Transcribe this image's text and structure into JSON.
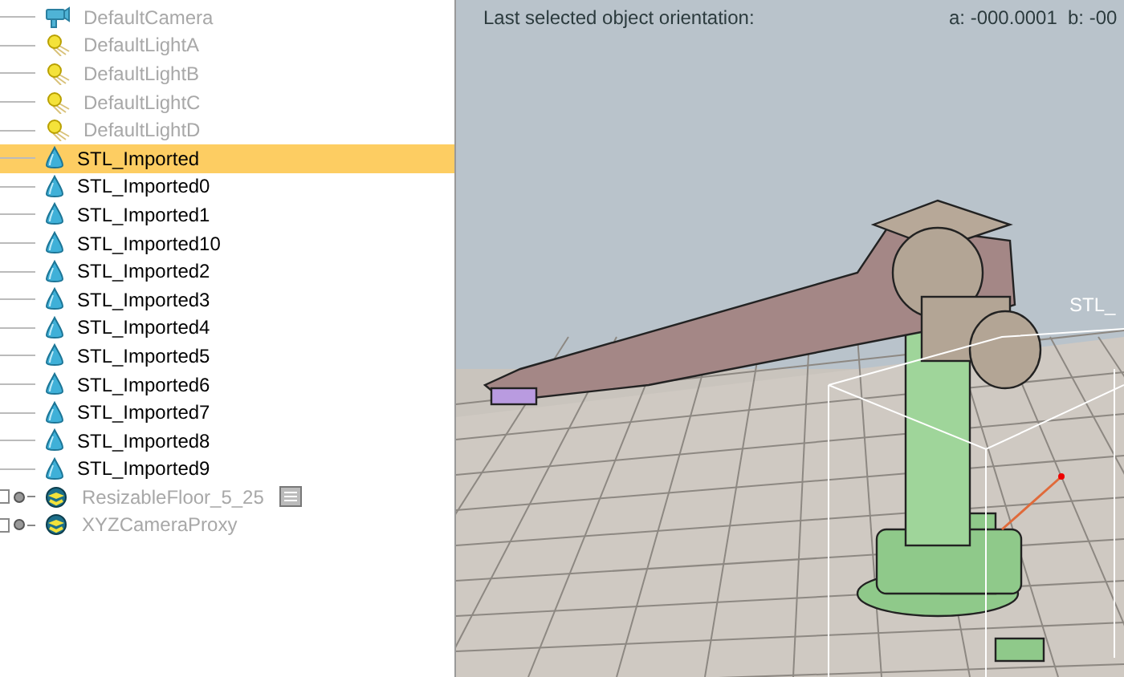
{
  "tree": {
    "items": [
      {
        "label": "DefaultCamera",
        "kind": "camera",
        "dimmed": true,
        "selected": false
      },
      {
        "label": "DefaultLightA",
        "kind": "light",
        "dimmed": true,
        "selected": false
      },
      {
        "label": "DefaultLightB",
        "kind": "light",
        "dimmed": true,
        "selected": false
      },
      {
        "label": "DefaultLightC",
        "kind": "light",
        "dimmed": true,
        "selected": false
      },
      {
        "label": "DefaultLightD",
        "kind": "light",
        "dimmed": true,
        "selected": false
      },
      {
        "label": "STL_Imported",
        "kind": "mesh",
        "dimmed": false,
        "selected": true
      },
      {
        "label": "STL_Imported0",
        "kind": "mesh",
        "dimmed": false,
        "selected": false
      },
      {
        "label": "STL_Imported1",
        "kind": "mesh",
        "dimmed": false,
        "selected": false
      },
      {
        "label": "STL_Imported10",
        "kind": "mesh",
        "dimmed": false,
        "selected": false
      },
      {
        "label": "STL_Imported2",
        "kind": "mesh",
        "dimmed": false,
        "selected": false
      },
      {
        "label": "STL_Imported3",
        "kind": "mesh",
        "dimmed": false,
        "selected": false
      },
      {
        "label": "STL_Imported4",
        "kind": "mesh",
        "dimmed": false,
        "selected": false
      },
      {
        "label": "STL_Imported5",
        "kind": "mesh",
        "dimmed": false,
        "selected": false
      },
      {
        "label": "STL_Imported6",
        "kind": "mesh",
        "dimmed": false,
        "selected": false
      },
      {
        "label": "STL_Imported7",
        "kind": "mesh",
        "dimmed": false,
        "selected": false
      },
      {
        "label": "STL_Imported8",
        "kind": "mesh",
        "dimmed": false,
        "selected": false
      },
      {
        "label": "STL_Imported9",
        "kind": "mesh",
        "dimmed": false,
        "selected": false
      },
      {
        "label": "ResizableFloor_5_25",
        "kind": "model",
        "dimmed": true,
        "selected": false,
        "has_script": true
      },
      {
        "label": "XYZCameraProxy",
        "kind": "model",
        "dimmed": true,
        "selected": false,
        "has_script": false
      }
    ]
  },
  "viewport": {
    "info_label": "Last selected object orientation:",
    "info_a": "a: -000.0001",
    "info_b": "b: -00",
    "object_tag": "STL_"
  }
}
